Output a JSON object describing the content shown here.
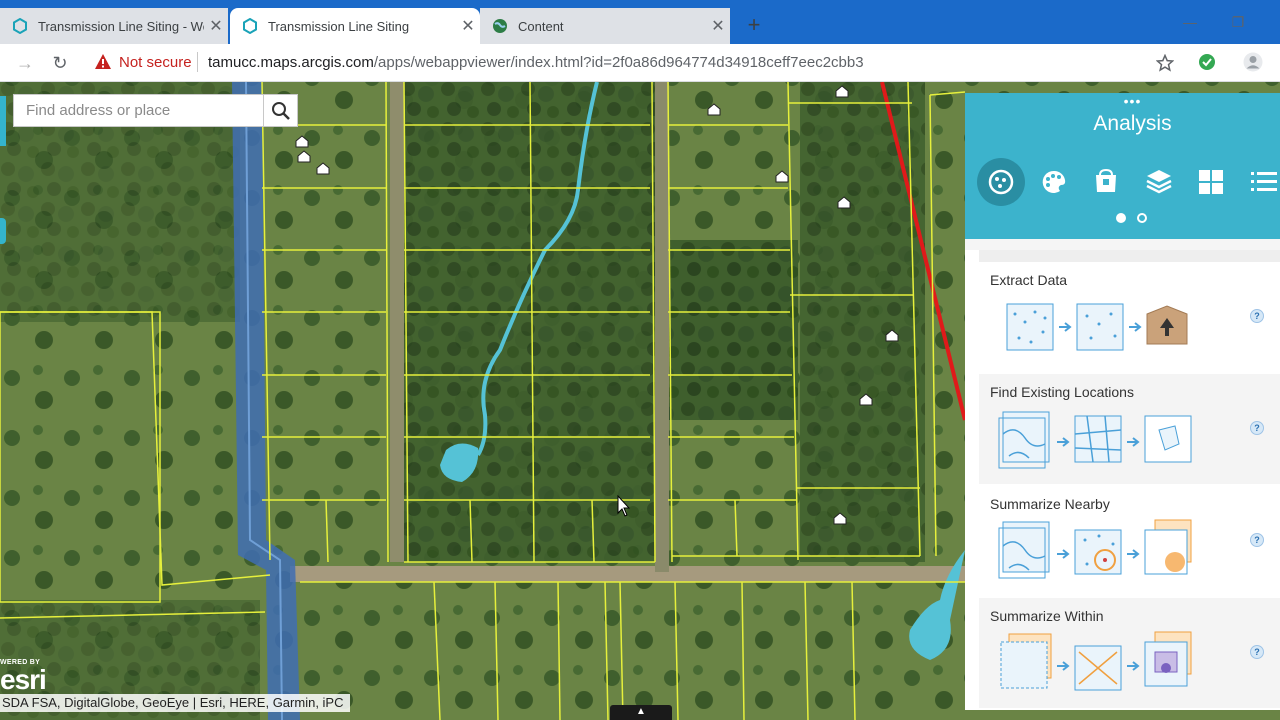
{
  "browser": {
    "tabs": [
      {
        "title": "Transmission Line Siting - Web A",
        "active": false
      },
      {
        "title": "Transmission Line Siting",
        "active": true
      },
      {
        "title": "Content",
        "active": false
      }
    ],
    "new_tab": "+",
    "security_label": "Not secure",
    "url_host": "tamucc.maps.arcgis.com",
    "url_path": "/apps/webappviewer/index.html?id=2f0a86d964774d34918ceff7eec2cbb3"
  },
  "map": {
    "search_placeholder": "Find address or place",
    "attribution": "SDA FSA, DigitalGlobe, GeoEye | Esri, HERE, Garmin, iPC",
    "logo_powered": "WERED BY",
    "logo_word": "esri"
  },
  "panel": {
    "handle": "•••",
    "title": "Analysis",
    "tools_icons": [
      "analysis-icon",
      "palette-icon",
      "basket-icon",
      "layers-icon",
      "grid-icon",
      "list-icon"
    ],
    "page_count": 2,
    "current_page": 1,
    "cards": [
      {
        "name": "Extract Data"
      },
      {
        "name": "Find Existing Locations"
      },
      {
        "name": "Summarize Nearby"
      },
      {
        "name": "Summarize Within"
      }
    ],
    "help_label": "?"
  },
  "colors": {
    "chrome_blue": "#1b6ac9",
    "panel_accent": "#3cb3cc",
    "parcel_line": "#e6f03c",
    "transmission_line": "#e01a1a",
    "water": "#55c2d6",
    "canal": "#3f6db3"
  }
}
